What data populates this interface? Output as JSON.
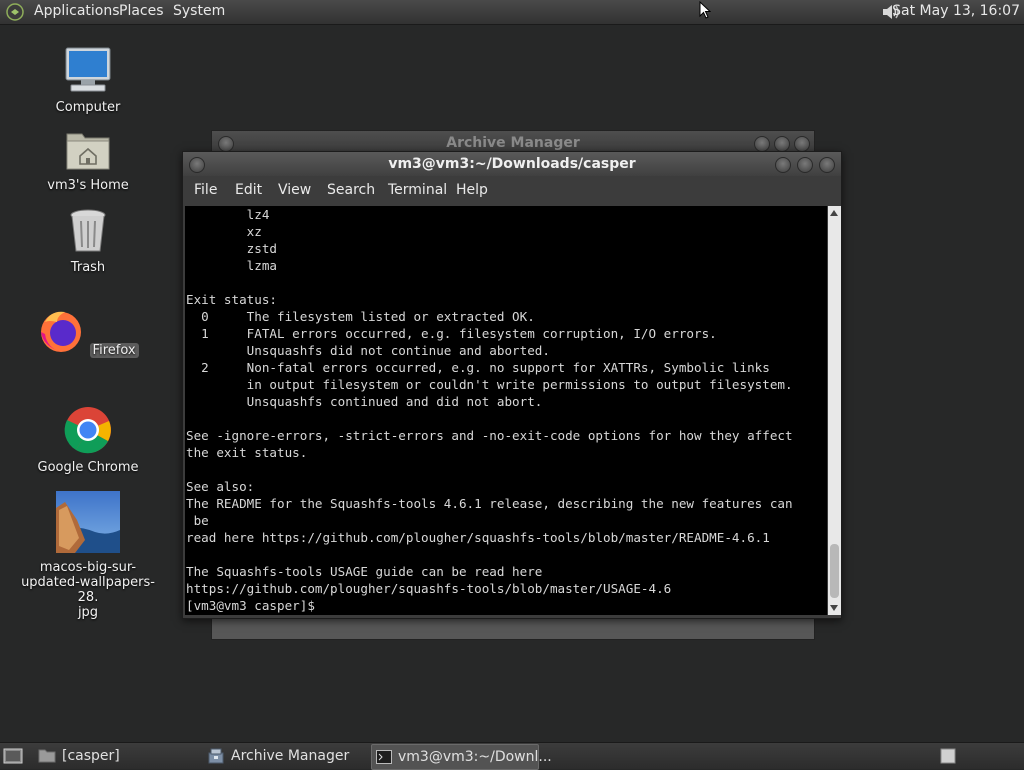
{
  "top_panel": {
    "menus": [
      "Applications",
      "Places",
      "System"
    ],
    "clock": "Sat May 13, 16:07",
    "icons": {
      "menu_logo": "gnome-foot-icon",
      "volume": "speaker-icon"
    }
  },
  "desktop": {
    "icons": [
      {
        "label": "Computer",
        "icon": "computer-icon"
      },
      {
        "label": "vm3's Home",
        "icon": "home-folder-icon"
      },
      {
        "label": "Trash",
        "icon": "trash-icon"
      },
      {
        "label": "Firefox",
        "icon": "firefox-icon"
      },
      {
        "label": "Google Chrome",
        "icon": "chrome-icon"
      },
      {
        "label": "macos-big-sur-updated-wallpapers-28.jpg",
        "label_lines": [
          "macos-big-sur-",
          "updated-wallpapers-28.",
          "jpg"
        ],
        "icon": "image-thumbnail-icon"
      }
    ]
  },
  "archive_window": {
    "title": "Archive Manager"
  },
  "terminal_window": {
    "title": "vm3@vm3:~/Downloads/casper",
    "menus": [
      "File",
      "Edit",
      "View",
      "Search",
      "Terminal",
      "Help"
    ],
    "lines": [
      "        lz4",
      "        xz",
      "        zstd",
      "        lzma",
      "",
      "Exit status:",
      "  0     The filesystem listed or extracted OK.",
      "  1     FATAL errors occurred, e.g. filesystem corruption, I/O errors.",
      "        Unsquashfs did not continue and aborted.",
      "  2     Non-fatal errors occurred, e.g. no support for XATTRs, Symbolic links",
      "        in output filesystem or couldn't write permissions to output filesystem.",
      "        Unsquashfs continued and did not abort.",
      "",
      "See -ignore-errors, -strict-errors and -no-exit-code options for how they affect",
      "the exit status.",
      "",
      "See also:",
      "The README for the Squashfs-tools 4.6.1 release, describing the new features can",
      " be",
      "read here https://github.com/plougher/squashfs-tools/blob/master/README-4.6.1",
      "",
      "The Squashfs-tools USAGE guide can be read here",
      "https://github.com/plougher/squashfs-tools/blob/master/USAGE-4.6",
      "[vm3@vm3 casper]$ "
    ]
  },
  "bottom_panel": {
    "tasks": [
      {
        "label": "[casper]",
        "icon": "folder-icon"
      },
      {
        "label": "Archive Manager",
        "icon": "archive-manager-icon"
      },
      {
        "label": "vm3@vm3:~/Downl...",
        "icon": "terminal-icon",
        "active": true
      }
    ]
  }
}
